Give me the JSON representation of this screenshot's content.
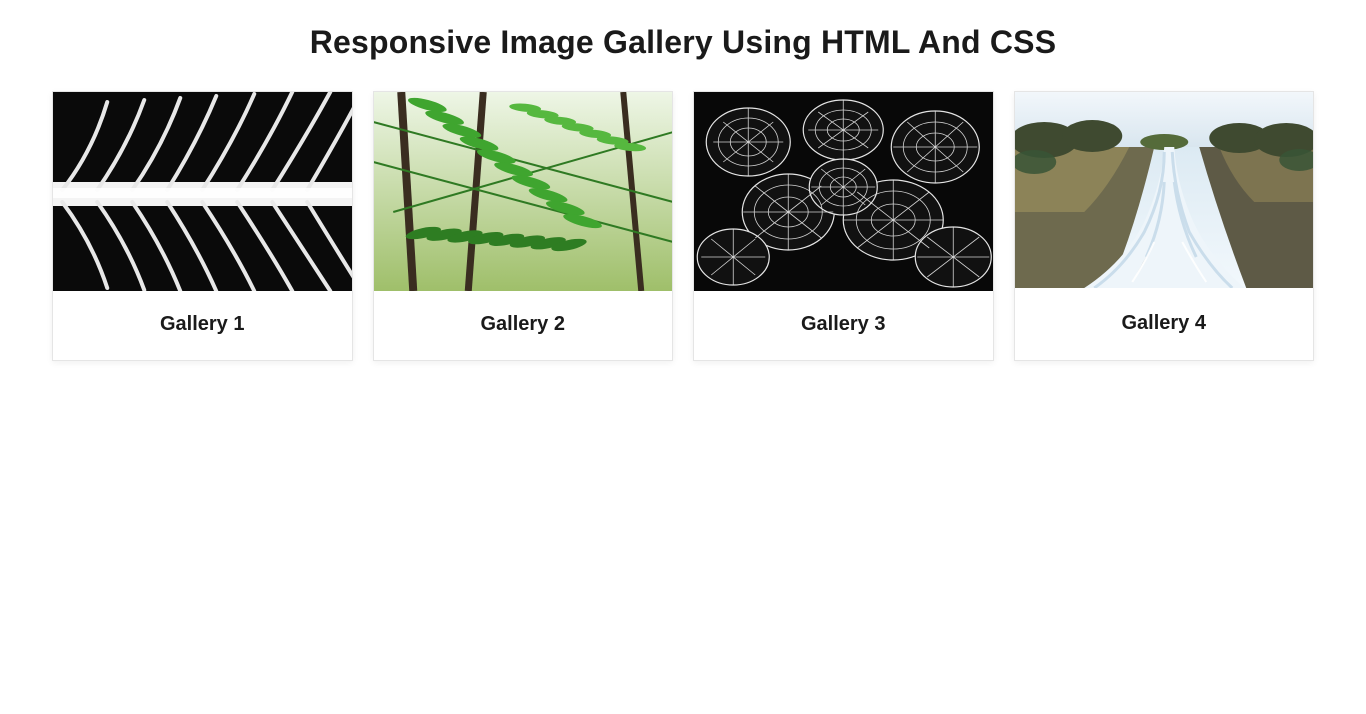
{
  "header": {
    "title": "Responsive Image Gallery Using HTML And CSS"
  },
  "gallery": {
    "items": [
      {
        "label": "Gallery 1",
        "alt": "black-and-white-leaf-macro"
      },
      {
        "label": "Gallery 2",
        "alt": "green-fern-leaves"
      },
      {
        "label": "Gallery 3",
        "alt": "many-veined-leaves-bw"
      },
      {
        "label": "Gallery 4",
        "alt": "river-rapids-landscape"
      }
    ]
  }
}
